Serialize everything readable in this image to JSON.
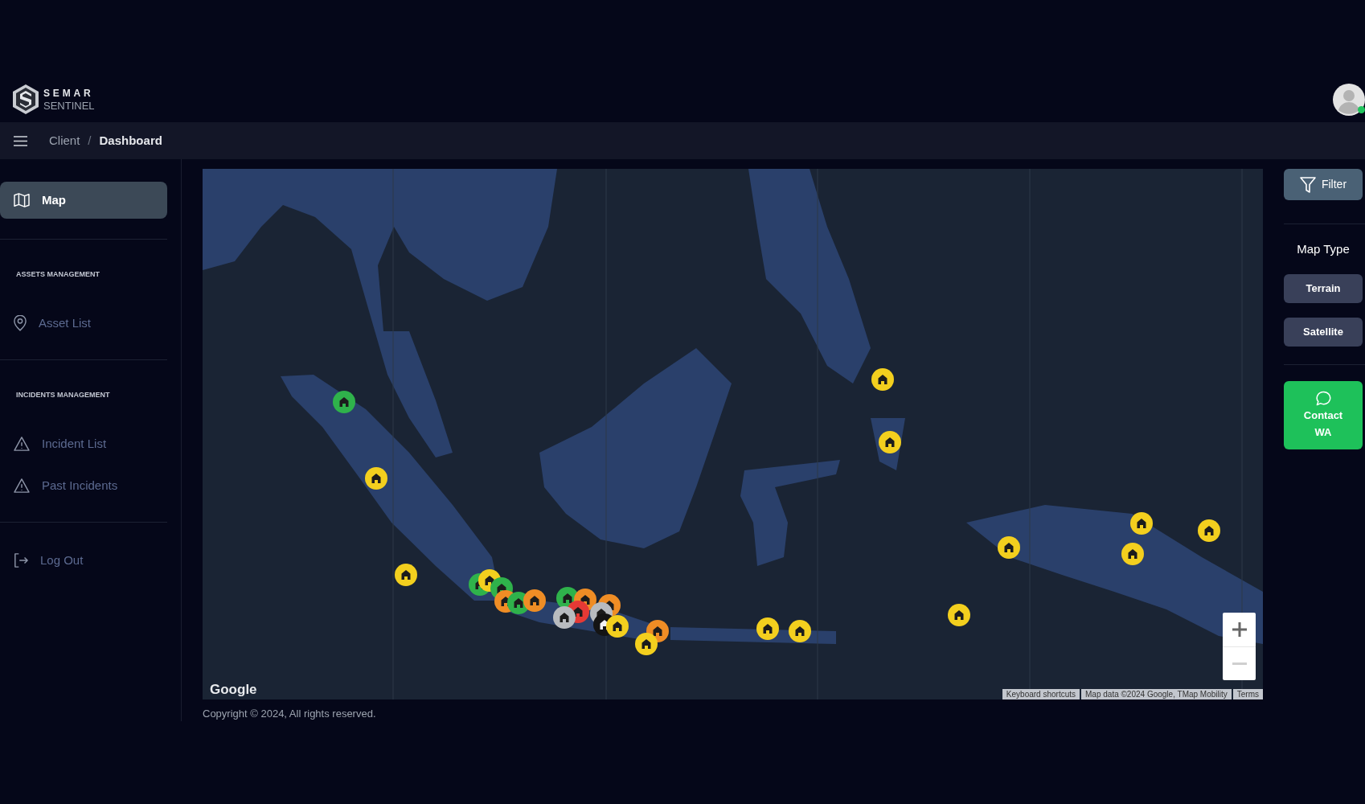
{
  "header": {
    "logo": {
      "line_1": "SEMAR",
      "line_2": "SENTINEL"
    },
    "avatar": {
      "online": true
    }
  },
  "breadcrumb": {
    "items": [
      {
        "label": "Client",
        "current": false
      },
      {
        "label": "Dashboard",
        "current": true
      }
    ],
    "separator": "/"
  },
  "sidebar": {
    "sections": [
      {
        "items": [
          {
            "kind": "map",
            "label": "Map",
            "selected": true
          }
        ]
      },
      {
        "heading": "ASSETS MANAGEMENT",
        "items": [
          {
            "kind": "pin",
            "label": "Asset List",
            "selected": false
          }
        ]
      },
      {
        "heading": "INCIDENTS MANAGEMENT",
        "items": [
          {
            "kind": "warning",
            "label": "Incident List",
            "selected": false
          },
          {
            "kind": "warning",
            "label": "Past Incidents",
            "selected": false
          }
        ]
      },
      {
        "items": [
          {
            "kind": "logout",
            "label": "Log Out",
            "selected": false
          }
        ]
      }
    ]
  },
  "map": {
    "markers": [
      {
        "color": "#2fb24b"
      },
      {
        "color": "#f3cf1e"
      },
      {
        "color": "#f3cf1e"
      },
      {
        "color": "#2fb24b"
      },
      {
        "color": "#f3cf1e"
      },
      {
        "color": "#2fb24b"
      },
      {
        "color": "#ef8d25"
      },
      {
        "color": "#2fb24b"
      },
      {
        "color": "#ef8d25"
      },
      {
        "color": "#2fb24b"
      },
      {
        "color": "#ef8d25"
      },
      {
        "color": "#e53935"
      },
      {
        "color": "#b8bbbf"
      },
      {
        "color": "#ef8d25"
      },
      {
        "color": "#b8bbbf"
      },
      {
        "color": "#141414"
      },
      {
        "color": "#f3cf1e"
      },
      {
        "color": "#ef8d25"
      },
      {
        "color": "#f3cf1e"
      },
      {
        "color": "#f3cf1e"
      },
      {
        "color": "#f3cf1e"
      },
      {
        "color": "#f3cf1e"
      },
      {
        "color": "#f3cf1e"
      },
      {
        "color": "#f3cf1e"
      },
      {
        "color": "#f3cf1e"
      },
      {
        "color": "#f3cf1e"
      },
      {
        "color": "#f3cf1e"
      },
      {
        "color": "#f3cf1e"
      }
    ],
    "google_logo": "Google",
    "zoom_controls": [
      {
        "kind": "in",
        "disabled": false
      },
      {
        "kind": "out",
        "disabled": true
      }
    ],
    "attribution": [
      "Keyboard shortcuts",
      "Map data ©2024 Google, TMap Mobility",
      "Terms"
    ]
  },
  "right_panel": {
    "filter_button": "Filter",
    "map_type": {
      "heading": "Map Type",
      "options": [
        {
          "label": "Terrain",
          "selected": false
        },
        {
          "label": "Satellite",
          "selected": false
        }
      ]
    },
    "contact_button": "Contact WA"
  },
  "footer": {
    "copyright": "Copyright © 2024, All rights reserved."
  }
}
